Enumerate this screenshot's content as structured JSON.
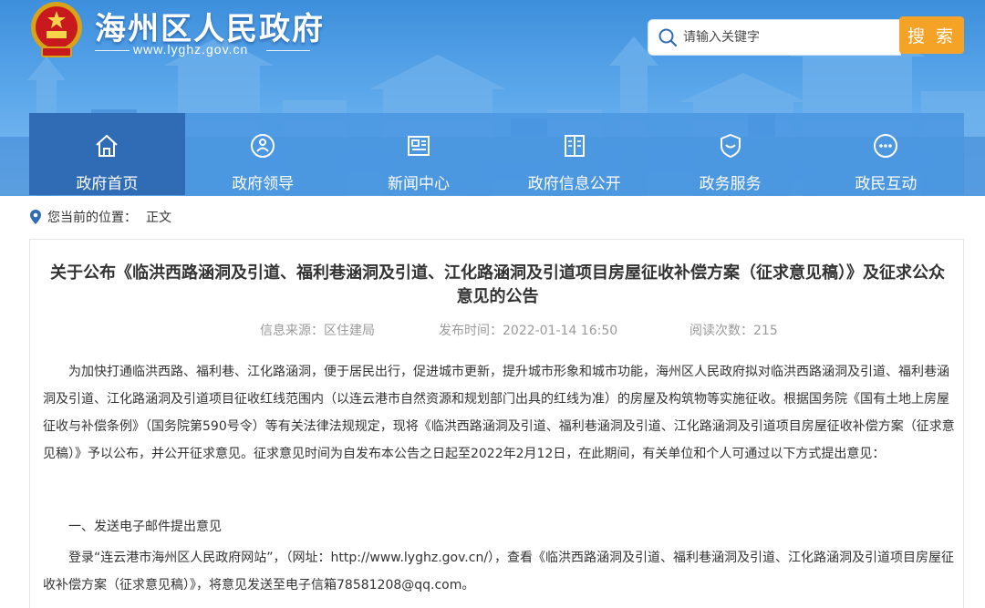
{
  "header": {
    "site_title": "海州区人民政府",
    "site_url": "www.lyghz.gov.cn",
    "search_placeholder": "请输入关键字",
    "search_button": "搜 索",
    "colors": {
      "banner": "#4b9be4",
      "accent": "#f5a326",
      "nav_active": "#2f6cb5"
    }
  },
  "nav": {
    "items": [
      {
        "label": "政府首页",
        "icon": "home-icon",
        "active": true
      },
      {
        "label": "政府领导",
        "icon": "leader-icon",
        "active": false
      },
      {
        "label": "新闻中心",
        "icon": "news-icon",
        "active": false
      },
      {
        "label": "政府信息公开",
        "icon": "book-icon",
        "active": false
      },
      {
        "label": "政务服务",
        "icon": "shield-icon",
        "active": false
      },
      {
        "label": "政民互动",
        "icon": "chat-icon",
        "active": false
      }
    ]
  },
  "breadcrumb": {
    "prefix": "您当前的位置：",
    "current": "正文"
  },
  "article": {
    "title": "关于公布《临洪西路涵洞及引道、福利巷涵洞及引道、江化路涵洞及引道项目房屋征收补偿方案（征求意见稿）》及征求公众意见的公告",
    "source": "信息来源：区住建局",
    "published": "发布时间：2022-01-14 16:50",
    "views": "阅读次数：215",
    "paragraph1": "为加快打通临洪西路、福利巷、江化路涵洞，便于居民出行，促进城市更新，提升城市形象和城市功能，海州区人民政府拟对临洪西路涵洞及引道、福利巷涵洞及引道、江化路涵洞及引道项目征收红线范围内（以连云港市自然资源和规划部门出具的红线为准）的房屋及构筑物等实施征收。根据国务院《国有土地上房屋征收与补偿条例》（国务院第590号令）等有关法律法规规定，现将《临洪西路涵洞及引道、福利巷涵洞及引道、江化路涵洞及引道项目房屋征收补偿方案（征求意见稿）》予以公布，并公开征求意见。征求意见时间为自发布本公告之日起至2022年2月12日，在此期间，有关单位和个人可通过以下方式提出意见：",
    "heading1": "一、发送电子邮件提出意见",
    "paragraph2": "登录“连云港市海州区人民政府网站”，（网址：http://www.lyghz.gov.cn/），查看《临洪西路涵洞及引道、福利巷涵洞及引道、江化路涵洞及引道项目房屋征收补偿方案（征求意见稿）》，将意见发送至电子信箱78581208@qq.com。"
  }
}
